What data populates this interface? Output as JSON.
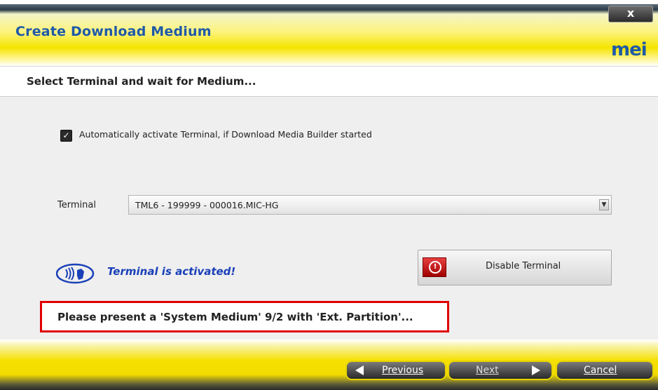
{
  "window": {
    "title": "Create Download Medium",
    "close_label": "x",
    "logo_text": "mei"
  },
  "section": {
    "title": "Select Terminal and wait for Medium..."
  },
  "auto_activate": {
    "checked": true,
    "label": "Automatically activate Terminal, if Download Media Builder started"
  },
  "terminal": {
    "label": "Terminal",
    "selected_value": "TML6 - 199999 - 000016.MIC-HG"
  },
  "status": {
    "text": "Terminal is activated!",
    "icon": "contactless-icon"
  },
  "disable_button": {
    "label": "Disable Terminal",
    "icon": "power-icon"
  },
  "message": {
    "text": "Please present a 'System Medium' 9/2 with 'Ext. Partition'..."
  },
  "footer": {
    "previous_label": "Previous",
    "next_label": "Next",
    "cancel_label": "Cancel"
  },
  "colors": {
    "title": "#1e5aa8",
    "status": "#1a40b8",
    "highlight_border": "#e00000",
    "accent_yellow": "#f5e400"
  }
}
